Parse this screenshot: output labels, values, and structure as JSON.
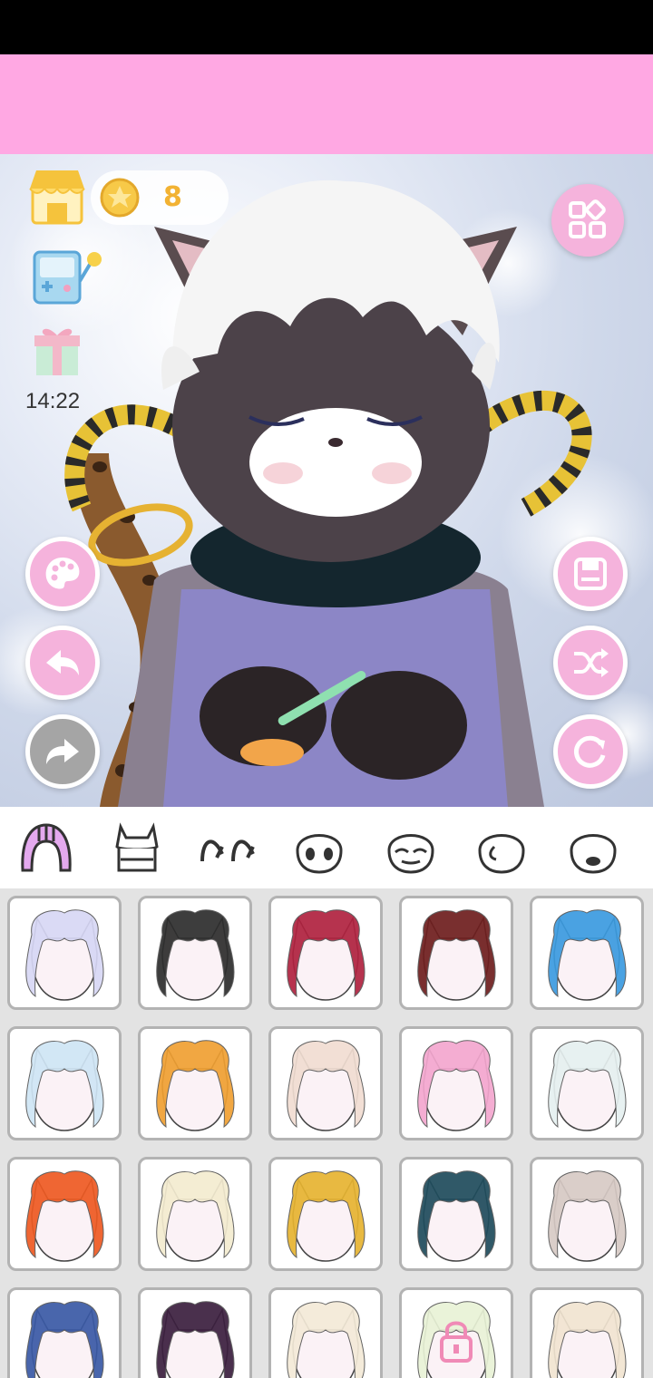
{
  "app": {
    "banner_color": "#ffa8e3",
    "accent_color": "#f5b3dc",
    "coins": "8",
    "timer": "14:22"
  },
  "left_icons": [
    "shop-icon",
    "minigame-icon",
    "gift-icon"
  ],
  "side_buttons": {
    "left": [
      "palette-button",
      "undo-button",
      "redo-button"
    ],
    "right": [
      "menu-button",
      "save-button",
      "shuffle-button",
      "reset-button"
    ]
  },
  "category_tabs": [
    "hair-front",
    "horns",
    "ears",
    "head-shape",
    "eyes-closed-face",
    "face-side",
    "mouth-face"
  ],
  "items": {
    "rows": [
      [
        {
          "name": "white-lavender-hair",
          "color": "#d7d7f5",
          "locked": false
        },
        {
          "name": "black-beaded-braids",
          "color": "#2d2d2d",
          "locked": false
        },
        {
          "name": "red-spiky-hair",
          "color": "#b0223f",
          "locked": false
        },
        {
          "name": "dark-red-long-hair",
          "color": "#6e1e1e",
          "locked": false
        },
        {
          "name": "blue-spiky-hair",
          "color": "#3b9be0",
          "locked": false
        }
      ],
      [
        {
          "name": "light-blue-spiky-hair",
          "color": "#cfe5f5",
          "locked": false
        },
        {
          "name": "rainbow-hair",
          "color": "#f0a032",
          "locked": false
        },
        {
          "name": "cream-spiky-hair",
          "color": "#f1ddd2",
          "locked": false
        },
        {
          "name": "pink-curly-hair",
          "color": "#f4a7cf",
          "locked": false
        },
        {
          "name": "white-mint-hair",
          "color": "#e6f0f0",
          "locked": false
        }
      ],
      [
        {
          "name": "orange-braided-hair",
          "color": "#ee5a22",
          "locked": false
        },
        {
          "name": "blonde-wavy-hair",
          "color": "#f4ecd0",
          "locked": false
        },
        {
          "name": "egyptian-headdress",
          "color": "#e7b431",
          "locked": false
        },
        {
          "name": "teal-snake-hair",
          "color": "#1f4c5c",
          "locked": false
        },
        {
          "name": "beige-long-hair",
          "color": "#d7cac5",
          "locked": false
        }
      ],
      [
        {
          "name": "navy-bandana-hair",
          "color": "#3a5aa5",
          "locked": false
        },
        {
          "name": "purple-dark-hair",
          "color": "#3b1f3e",
          "locked": false
        },
        {
          "name": "cream-fluffy-hair",
          "color": "#f3ead7",
          "locked": false
        },
        {
          "name": "pastel-locked-hair",
          "color": "#e9f2d6",
          "locked": true
        },
        {
          "name": "blonde-fluffy-hair",
          "color": "#f1e4d1",
          "locked": false
        }
      ]
    ]
  }
}
